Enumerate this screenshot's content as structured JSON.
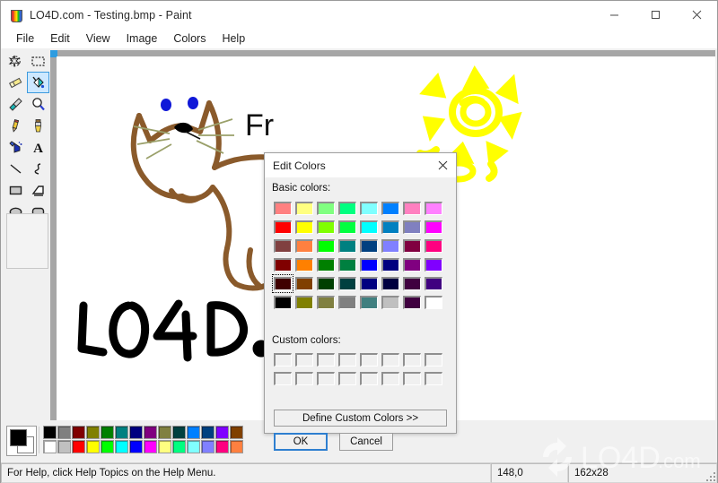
{
  "window": {
    "title": "LO4D.com - Testing.bmp - Paint",
    "icon": "paint-bucket-icon",
    "controls": [
      {
        "name": "minimize",
        "glyph": "minimize-icon"
      },
      {
        "name": "maximize",
        "glyph": "maximize-icon"
      },
      {
        "name": "close",
        "glyph": "close-icon"
      }
    ]
  },
  "menubar": {
    "items": [
      {
        "label": "File"
      },
      {
        "label": "Edit"
      },
      {
        "label": "View"
      },
      {
        "label": "Image"
      },
      {
        "label": "Colors"
      },
      {
        "label": "Help"
      }
    ]
  },
  "toolbox": {
    "tools": [
      {
        "name": "free-form-select-icon",
        "selected": false
      },
      {
        "name": "rectangle-select-icon",
        "selected": false
      },
      {
        "name": "eraser-icon",
        "selected": false
      },
      {
        "name": "fill-with-color-icon",
        "selected": true
      },
      {
        "name": "pick-color-icon",
        "selected": false
      },
      {
        "name": "magnifier-icon",
        "selected": false
      },
      {
        "name": "pencil-icon",
        "selected": false
      },
      {
        "name": "brush-icon",
        "selected": false
      },
      {
        "name": "airbrush-icon",
        "selected": false
      },
      {
        "name": "text-icon",
        "selected": false
      },
      {
        "name": "line-icon",
        "selected": false
      },
      {
        "name": "curve-icon",
        "selected": false
      },
      {
        "name": "rectangle-icon",
        "selected": false
      },
      {
        "name": "polygon-icon",
        "selected": false
      },
      {
        "name": "ellipse-icon",
        "selected": false
      },
      {
        "name": "rounded-rectangle-icon",
        "selected": false
      }
    ]
  },
  "canvas": {
    "drawings": [
      {
        "name": "cat-drawing",
        "color": "#8a5a2b",
        "eye_color": "#1018d8",
        "nose_color": "#000000",
        "whisker_color": "#9aa06a"
      },
      {
        "name": "sun-drawing",
        "color": "#ffff00"
      },
      {
        "name": "lo4d-text-drawing",
        "color": "#000000",
        "text": "LO4D.c"
      },
      {
        "name": "fr-text-drawing",
        "color": "#000000",
        "text": "Fr"
      }
    ]
  },
  "dialog": {
    "title": "Edit Colors",
    "close_icon": "close-icon",
    "basic_colors_label": "Basic colors:",
    "custom_colors_label": "Custom colors:",
    "selected_index": 32,
    "basic_colors": [
      "#ff8080",
      "#ffff80",
      "#80ff80",
      "#00ff80",
      "#80ffff",
      "#0080ff",
      "#ff80c0",
      "#ff80ff",
      "#ff0000",
      "#ffff00",
      "#80ff00",
      "#00ff40",
      "#00ffff",
      "#0080c0",
      "#8080c0",
      "#ff00ff",
      "#804040",
      "#ff8040",
      "#00ff00",
      "#008080",
      "#004080",
      "#8080ff",
      "#800040",
      "#ff0080",
      "#800000",
      "#ff8000",
      "#008000",
      "#008040",
      "#0000ff",
      "#000080",
      "#800080",
      "#8000ff",
      "#400000",
      "#804000",
      "#004000",
      "#004040",
      "#000080",
      "#000040",
      "#400040",
      "#400080",
      "#000000",
      "#808000",
      "#808040",
      "#808080",
      "#408080",
      "#c0c0c0",
      "#400040",
      "#ffffff"
    ],
    "custom_colors_count": 16,
    "buttons": {
      "define": "Define Custom Colors >>",
      "ok": "OK",
      "cancel": "Cancel"
    }
  },
  "palette": {
    "foreground": "#000000",
    "background": "#ffffff",
    "row_top": [
      "#000000",
      "#808080",
      "#800000",
      "#808000",
      "#008000",
      "#008080",
      "#000080",
      "#800080",
      "#808040",
      "#004040",
      "#0080ff",
      "#004080",
      "#8000ff",
      "#804000"
    ],
    "row_bottom": [
      "#ffffff",
      "#c0c0c0",
      "#ff0000",
      "#ffff00",
      "#00ff00",
      "#00ffff",
      "#0000ff",
      "#ff00ff",
      "#ffff80",
      "#00ff80",
      "#80ffff",
      "#8080ff",
      "#ff0080",
      "#ff8040"
    ]
  },
  "statusbar": {
    "help_text": "For Help, click Help Topics on the Help Menu.",
    "coordinates": "148,0",
    "selection_size": "162x28"
  },
  "watermark": {
    "text": "LO4D",
    "suffix": ".com"
  }
}
